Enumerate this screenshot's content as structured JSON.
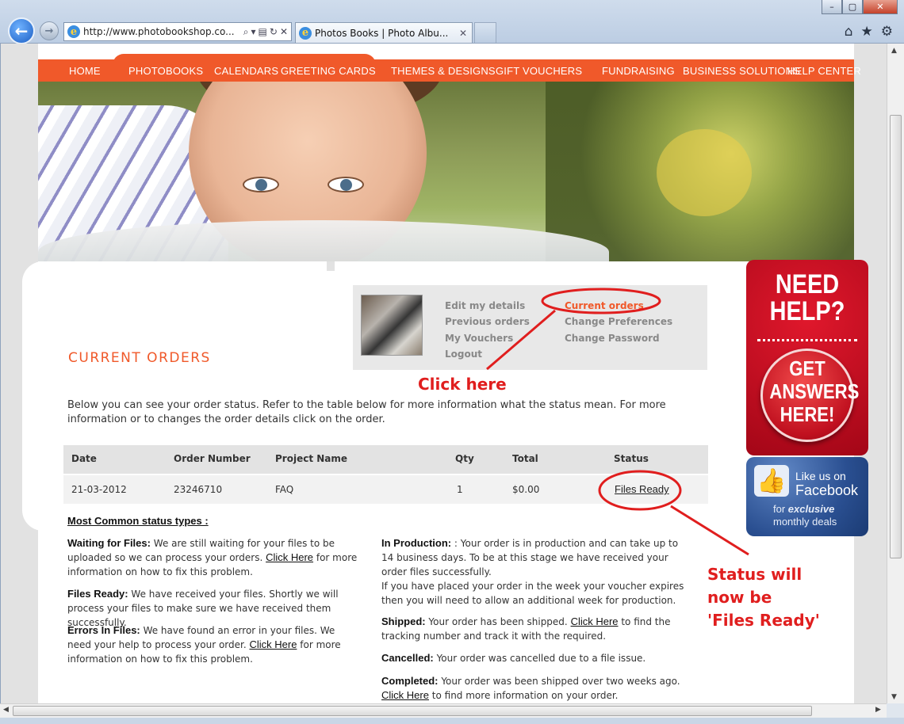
{
  "browser": {
    "address": "http://www.photobookshop.co...",
    "tab_title": "Photos Books | Photo Albu...",
    "tab_close": "✕",
    "window_buttons": [
      "–",
      "▢",
      "✕"
    ],
    "icons": [
      "home-icon",
      "favorites-star-icon",
      "gear-icon"
    ]
  },
  "nav": {
    "items": [
      "HOME",
      "PHOTOBOOKS",
      "CALENDARS",
      "GREETING CARDS",
      "THEMES & DESIGNS",
      "GIFT VOUCHERS",
      "FUNDRAISING",
      "BUSINESS SOLUTIONS",
      "HELP CENTER"
    ],
    "accent": "#f0592a"
  },
  "account_menu": {
    "left": [
      "Edit my details",
      "Previous orders",
      "My Vouchers",
      "Logout"
    ],
    "right": [
      "Current orders",
      "Change Preferences",
      "Change Password"
    ]
  },
  "page": {
    "title": "CURRENT ORDERS",
    "intro": "Below you can see your order status. Refer to the table below for more information what the status mean. For more information or to changes the order details click on the order."
  },
  "orders": {
    "headers": [
      "Date",
      "Order Number",
      "Project Name",
      "Qty",
      "Total",
      "Status"
    ],
    "rows": [
      {
        "date": "21-03-2012",
        "order_number": "23246710",
        "project": "FAQ",
        "qty": "1",
        "total": "$0.00",
        "status": "Files Ready"
      }
    ]
  },
  "status_types": {
    "title": "Most Common status types :",
    "waiting": {
      "label": "Waiting for Files:",
      "text_a": " We are still waiting for your files to be uploaded so we can process your orders. ",
      "link": "Click Here",
      "text_b": " for more information on how to fix this problem."
    },
    "ready": {
      "label": "Files Ready:",
      "text": " We have received your files. Shortly we will process your files to make sure we have received them successfully."
    },
    "errors": {
      "label": "Errors In Files:",
      "text_a": " We have found an error in your files. We need your help to process your order. ",
      "link": "Click Here",
      "text_b": " for more information on how to fix this problem."
    },
    "production": {
      "label": "In Production:",
      "text": " : Your order is in production and can take up to 14 business days. To be at this stage we have received your order files successfully.",
      "text2": "If you have placed your order in the week your voucher expires then you will need to allow an additional week for production."
    },
    "shipped": {
      "label": "Shipped:",
      "text_a": " Your order has been shipped. ",
      "link": "Click Here",
      "text_b": " to find the tracking number and track it with the required."
    },
    "cancelled": {
      "label": "Cancelled:",
      "text": " Your order was cancelled due to a file issue."
    },
    "completed": {
      "label": "Completed:",
      "text": " Your order was been shipped over two weeks ago.",
      "link": "Click Here",
      "text_b": " to find more information on your order."
    }
  },
  "banners": {
    "help_top": "NEED HELP?",
    "help_button": "GET ANSWERS HERE!",
    "fb_line1": "Like us on",
    "fb_line2": "Facebook",
    "fb_line3_a": "for ",
    "fb_line3_b": "exclusive",
    "fb_line4": "monthly deals"
  },
  "annotations": {
    "click_here": "Click here",
    "status_note_1": "Status will",
    "status_note_2": "now be",
    "status_note_3": "'Files Ready'",
    "color": "#e01e1e"
  }
}
